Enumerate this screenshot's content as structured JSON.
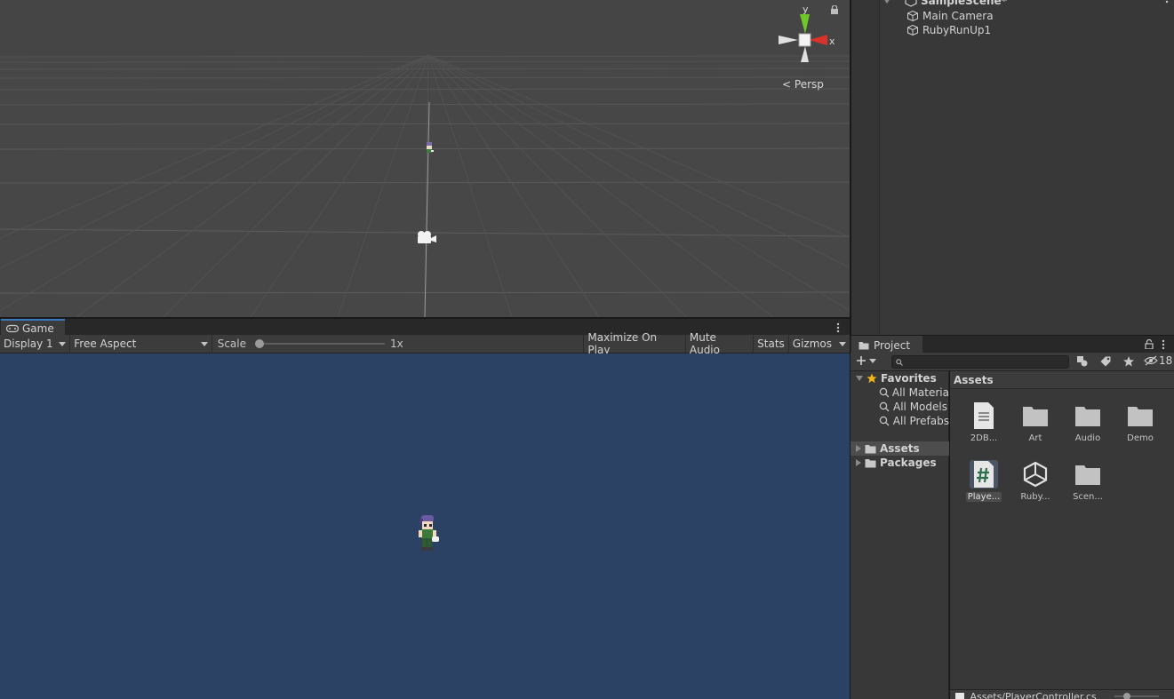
{
  "scene": {
    "axis_y": "y",
    "axis_x": "x",
    "persp_label": "Persp"
  },
  "hierarchy": {
    "scene_name": "SampleScene*",
    "objects": [
      "Main Camera",
      "RubyRunUp1"
    ]
  },
  "game": {
    "tab_label": "Game",
    "display": "Display 1",
    "aspect": "Free Aspect",
    "scale_label": "Scale",
    "scale_value": "1x",
    "scale_level": 0,
    "maximize_label": "Maximize On Play",
    "mute_label": "Mute Audio",
    "stats_label": "Stats",
    "gizmos_label": "Gizmos",
    "background_color": "#2b4265"
  },
  "project": {
    "tab_label": "Project",
    "hidden_count": "18",
    "favorites_label": "Favorites",
    "favorites": [
      "All Materia",
      "All Models",
      "All Prefabs"
    ],
    "roots": [
      "Assets",
      "Packages"
    ],
    "assets_header": "Assets",
    "assets": [
      {
        "label": "2DB...",
        "icon": "document-icon"
      },
      {
        "label": "Art",
        "icon": "folder-icon"
      },
      {
        "label": "Audio",
        "icon": "folder-icon"
      },
      {
        "label": "Demo",
        "icon": "folder-icon"
      },
      {
        "label": "Playe...",
        "icon": "csharp-script-icon"
      },
      {
        "label": "Ruby...",
        "icon": "unity-scene-icon"
      },
      {
        "label": "Scen...",
        "icon": "folder-icon"
      }
    ],
    "status_path": "Assets/PlayerController.cs"
  },
  "colors": {
    "accent": "#3a79bb",
    "axis_y": "#6fc72a",
    "axis_x": "#d8322a"
  }
}
